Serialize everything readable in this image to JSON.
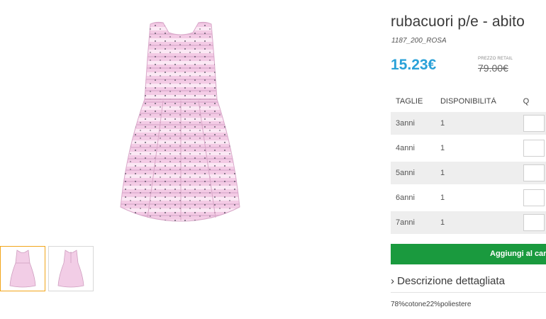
{
  "product": {
    "title": "rubacuori p/e - abito",
    "sku": "1187_200_ROSA",
    "price": "15.23€",
    "retail_label": "PREZZO RETAIL",
    "retail_price": "79.00€"
  },
  "sizes_table": {
    "headers": [
      "TAGLIE",
      "DISPONIBILITÀ",
      "Q"
    ],
    "rows": [
      {
        "size": "3anni",
        "availability": "1"
      },
      {
        "size": "4anni",
        "availability": "1"
      },
      {
        "size": "5anni",
        "availability": "1"
      },
      {
        "size": "6anni",
        "availability": "1"
      },
      {
        "size": "7anni",
        "availability": "1"
      }
    ]
  },
  "cart": {
    "label": "Aggiungi al carr"
  },
  "description": {
    "toggle_label": "› Descrizione dettagliata",
    "text": "78%cotone22%poliestere"
  },
  "colors": {
    "price": "#2aa1d8",
    "cart_button": "#1a9a3e",
    "thumb_active_border": "#f2a51a",
    "dress_pink": "#f2cde6"
  }
}
